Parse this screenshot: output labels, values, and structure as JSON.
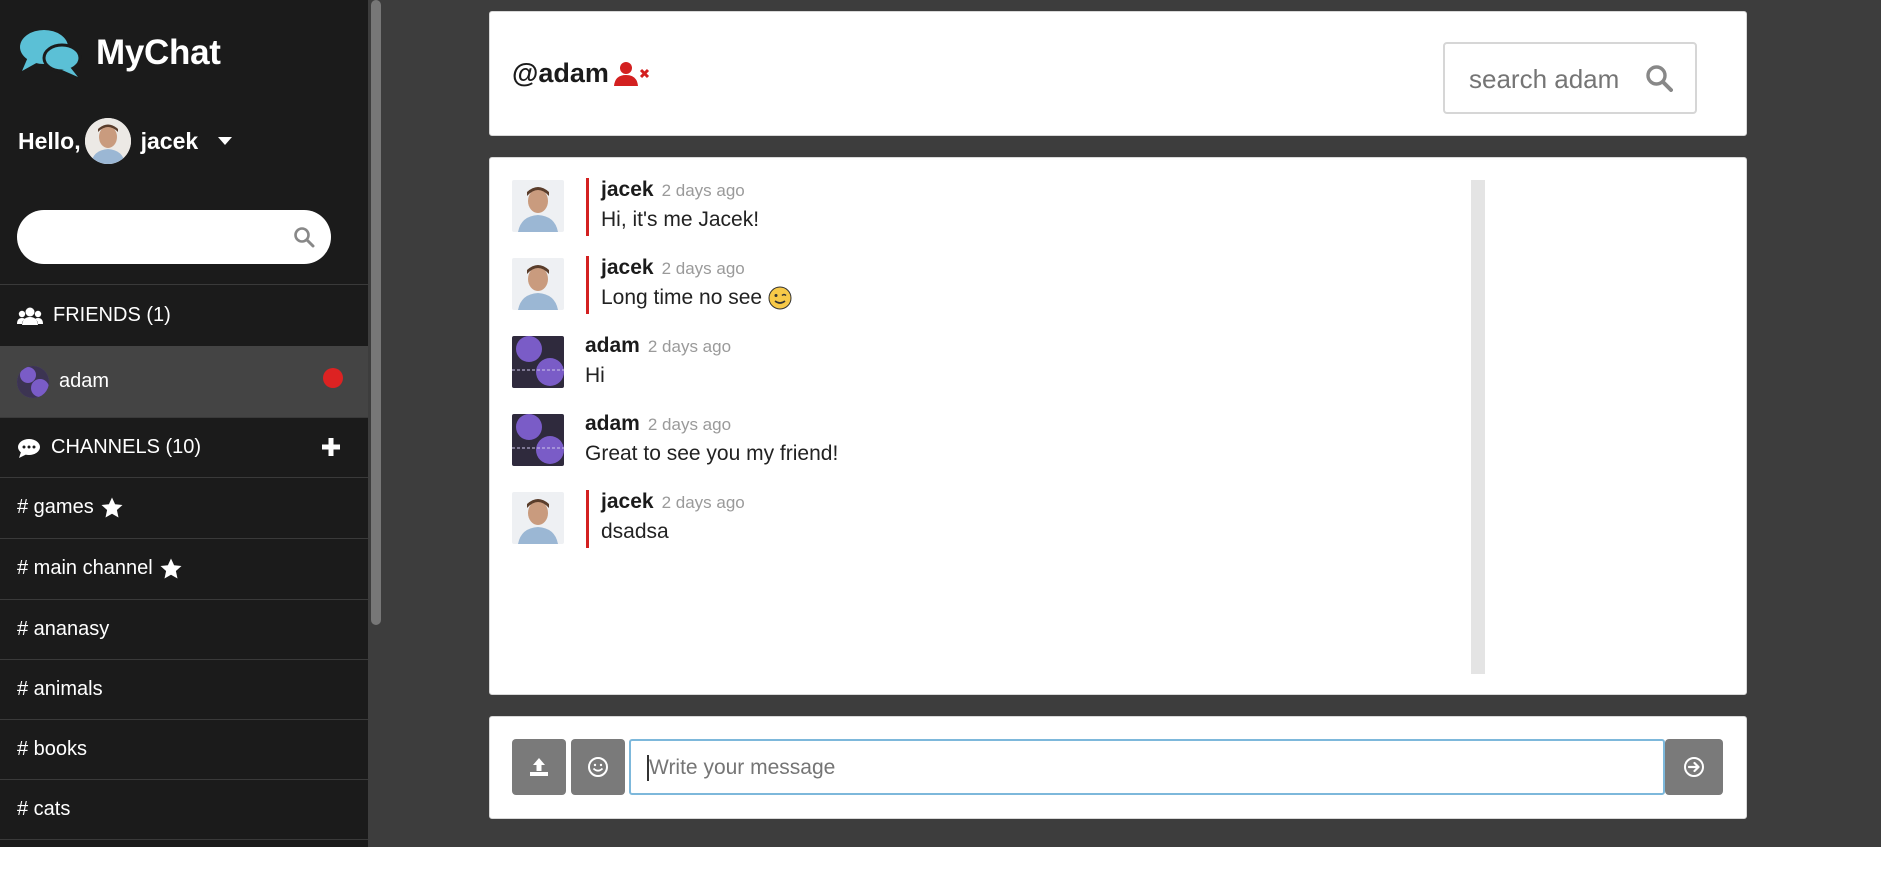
{
  "brand": {
    "name": "MyChat",
    "icon": "chat-bubbles-icon",
    "color": "#5bc0d6"
  },
  "user": {
    "greeting": "Hello,",
    "name": "jacek"
  },
  "sidebar": {
    "search_placeholder": "",
    "friends_header": "FRIENDS (1)",
    "friends": [
      {
        "name": "adam",
        "status_color": "#dd2222"
      }
    ],
    "channels_header": "CHANNELS (10)",
    "channels": [
      {
        "label": "# games",
        "starred": true
      },
      {
        "label": "# main channel",
        "starred": true
      },
      {
        "label": "# ananasy",
        "starred": false
      },
      {
        "label": "# animals",
        "starred": false
      },
      {
        "label": "# books",
        "starred": false
      },
      {
        "label": "# cats",
        "starred": false
      }
    ]
  },
  "chat": {
    "title": "@adam",
    "search_placeholder": "search adam",
    "remove_user_color": "#dd2222",
    "messages": [
      {
        "author": "jacek",
        "time": "2 days ago",
        "text": "Hi, it's me Jacek!",
        "own": true
      },
      {
        "author": "jacek",
        "time": "2 days ago",
        "text": "Long time no see",
        "own": true,
        "emoji": "wink"
      },
      {
        "author": "adam",
        "time": "2 days ago",
        "text": "Hi",
        "own": false
      },
      {
        "author": "adam",
        "time": "2 days ago",
        "text": "Great to see you my friend!",
        "own": false
      },
      {
        "author": "jacek",
        "time": "2 days ago",
        "text": "dsadsa",
        "own": true
      }
    ]
  },
  "composer": {
    "placeholder": "Write your message"
  },
  "colors": {
    "sidebar": "#1b1b1b",
    "background": "#3d3d3d",
    "accent_red": "#d32020",
    "button": "#7a7a7a"
  }
}
